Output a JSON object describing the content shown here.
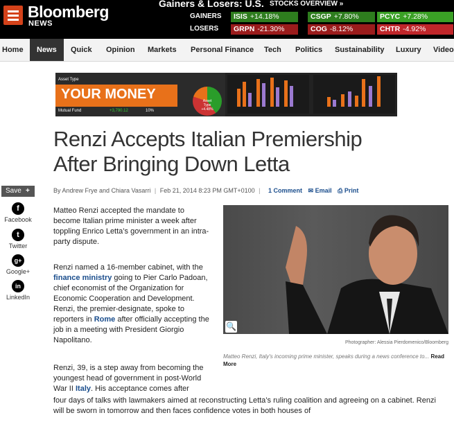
{
  "header": {
    "logo": "Bloomberg",
    "logo_sub": "NEWS",
    "gainers_title": "Gainers & Losers: U.S.",
    "overview_link": "STOCKS OVERVIEW »",
    "gainers_label": "GAINERS",
    "losers_label": "LOSERS",
    "gainers": [
      {
        "symbol": "ISIS",
        "change": "+14.18%"
      },
      {
        "symbol": "CSGP",
        "change": "+7.80%"
      },
      {
        "symbol": "PCYC",
        "change": "+7.28%"
      }
    ],
    "losers": [
      {
        "symbol": "GRPN",
        "change": "-21.30%"
      },
      {
        "symbol": "COG",
        "change": "-8.12%"
      },
      {
        "symbol": "CHTR",
        "change": "-4.92%"
      }
    ],
    "colors": {
      "gain_bg": "#2e7d1e",
      "gain_bg_light": "#3aa025",
      "loss_bg": "#9b1c1c",
      "loss_bg_light": "#c0262a"
    }
  },
  "nav": {
    "items": [
      "Home",
      "News",
      "Quick",
      "Opinion",
      "Markets",
      "Personal Finance",
      "Tech",
      "Politics",
      "Sustainability",
      "Luxury",
      "Video"
    ],
    "active": "News"
  },
  "ad": {
    "asset_type": "Asset Type",
    "title": "YOUR MONEY",
    "mutual_fund": "Mutual Fund",
    "amount": "+3,790.12",
    "percent": "10%",
    "pie_label": "Asset Type +4.48%"
  },
  "article": {
    "headline": "Renzi Accepts Italian Premiership After Bringing Down Letta",
    "authors": "By Andrew Frye and Chiara Vasarri",
    "date": "Feb 21, 2014 8:23 PM GMT+0100",
    "comments": "1 Comment",
    "email": "Email",
    "print": "Print",
    "p1": "Matteo Renzi accepted the mandate to become Italian prime minister a week after toppling Enrico Letta’s government in an intra-party dispute.",
    "p2_a": "Renzi named a 16-member cabinet, with the ",
    "p2_link1": "finance ministry",
    "p2_b": " going to Pier Carlo Padoan, chief economist of the Organization for Economic Cooperation and Development. Renzi, the premier-designate, spoke to reporters in ",
    "p2_link2": "Rome",
    "p2_c": " after officially accepting the job in a meeting with President Giorgio Napolitano.",
    "p3_a": "Renzi, 39, is a step away from becoming the youngest head of government in post-World War II ",
    "p3_link": "Italy",
    "p3_b": ". His acceptance comes after",
    "p4": "four days of talks with lawmakers aimed at reconstructing Letta’s ruling coalition and agreeing on a cabinet. Renzi will be sworn in tomorrow and then faces confidence votes in both houses of",
    "photo_credit": "Photographer: Alessia Pierdomenico/Bloomberg",
    "caption": "Matteo Renzi, Italy's incoming prime minister, speaks during a news conference to...",
    "read_more": "Read More"
  },
  "share": {
    "label": "Save",
    "plus": "+",
    "items": [
      {
        "glyph": "f",
        "label": "Facebook"
      },
      {
        "glyph": "t",
        "label": "Twitter"
      },
      {
        "glyph": "g+",
        "label": "Google+"
      },
      {
        "glyph": "in",
        "label": "LinkedIn"
      }
    ]
  }
}
